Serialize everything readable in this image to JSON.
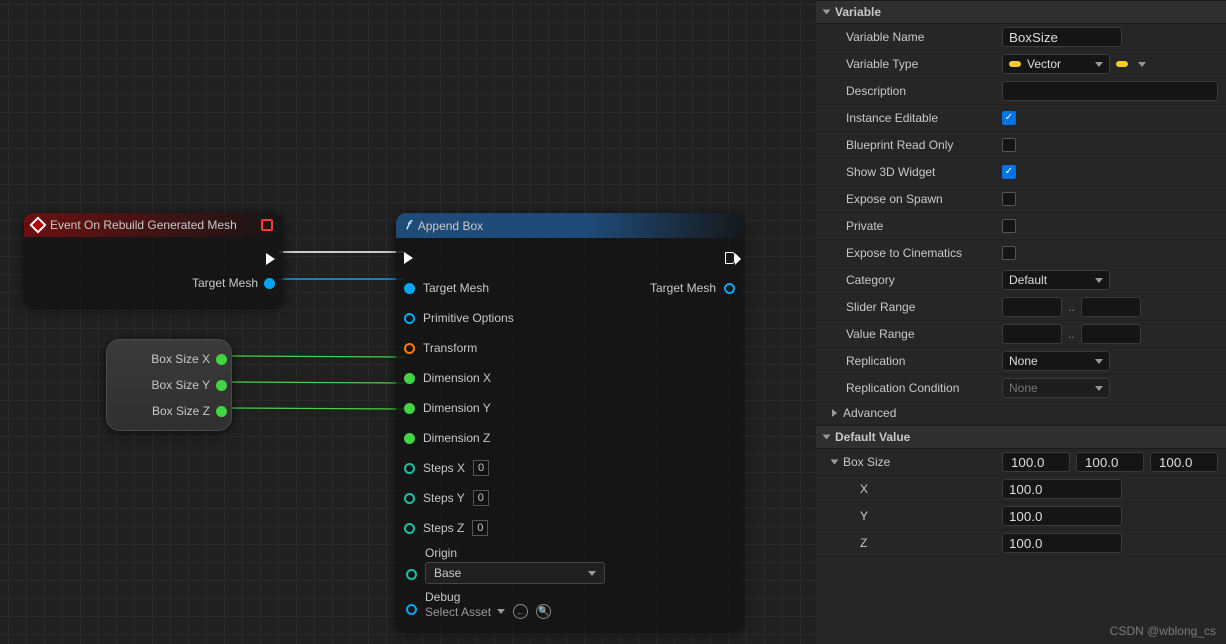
{
  "graph": {
    "event_node": {
      "title": "Event On Rebuild Generated Mesh",
      "outputs": {
        "target_mesh": "Target Mesh"
      }
    },
    "var_node": {
      "rows": [
        {
          "label": "Box Size X"
        },
        {
          "label": "Box Size Y"
        },
        {
          "label": "Box Size Z"
        }
      ]
    },
    "fn_node": {
      "title": "Append Box",
      "inputs": {
        "target_mesh": "Target Mesh",
        "primitive_options": "Primitive Options",
        "transform": "Transform",
        "dim_x": "Dimension X",
        "dim_y": "Dimension Y",
        "dim_z": "Dimension Z",
        "steps_x": "Steps X",
        "steps_y": "Steps Y",
        "steps_z": "Steps Z",
        "origin_label": "Origin",
        "origin_value": "Base",
        "debug_label": "Debug",
        "debug_value": "Select Asset",
        "step_default": "0"
      },
      "outputs": {
        "target_mesh": "Target Mesh"
      }
    }
  },
  "details": {
    "sections": {
      "variable": "Variable",
      "advanced": "Advanced",
      "default_value": "Default Value",
      "box_size_sub": "Box Size"
    },
    "rows": {
      "variable_name": {
        "label": "Variable Name",
        "value": "BoxSize"
      },
      "variable_type": {
        "label": "Variable Type",
        "value": "Vector"
      },
      "description": {
        "label": "Description",
        "value": ""
      },
      "instance_editable": {
        "label": "Instance Editable",
        "checked": true
      },
      "blueprint_read_only": {
        "label": "Blueprint Read Only",
        "checked": false
      },
      "show_3d_widget": {
        "label": "Show 3D Widget",
        "checked": true
      },
      "expose_on_spawn": {
        "label": "Expose on Spawn",
        "checked": false
      },
      "private": {
        "label": "Private",
        "checked": false
      },
      "expose_to_cinematics": {
        "label": "Expose to Cinematics",
        "checked": false
      },
      "category": {
        "label": "Category",
        "value": "Default"
      },
      "slider_range": {
        "label": "Slider Range",
        "min": "",
        "max": ""
      },
      "value_range": {
        "label": "Value Range",
        "min": "",
        "max": ""
      },
      "replication": {
        "label": "Replication",
        "value": "None"
      },
      "replication_condition": {
        "label": "Replication Condition",
        "value": "None"
      }
    },
    "default_value": {
      "vec": {
        "x": "100.0",
        "y": "100.0",
        "z": "100.0"
      },
      "components": {
        "x_label": "X",
        "y_label": "Y",
        "z_label": "Z",
        "x": "100.0",
        "y": "100.0",
        "z": "100.0"
      }
    }
  },
  "watermark": "CSDN @wblong_cs"
}
